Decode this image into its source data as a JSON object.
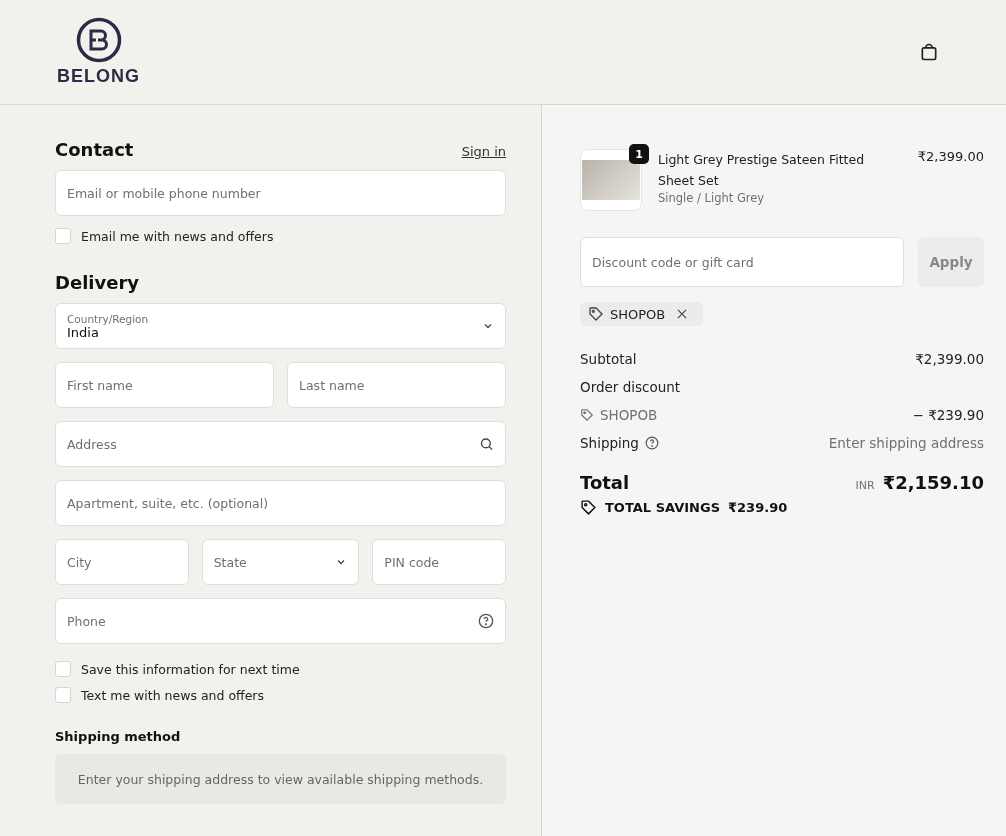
{
  "header": {
    "brand": "BELONG"
  },
  "contact": {
    "title": "Contact",
    "sign_in": "Sign in",
    "email": {
      "placeholder": "Email or mobile phone number"
    },
    "newsletter": {
      "label": "Email me with news and offers",
      "checked": false
    }
  },
  "delivery": {
    "title": "Delivery",
    "rows": [
      [
        {
          "kind": "select",
          "label": "Country/Region",
          "value": "India"
        }
      ],
      [
        {
          "kind": "text",
          "placeholder": "First name"
        },
        {
          "kind": "text",
          "placeholder": "Last name"
        }
      ],
      [
        {
          "kind": "search",
          "placeholder": "Address"
        }
      ],
      [
        {
          "kind": "text",
          "placeholder": "Apartment, suite, etc. (optional)"
        }
      ],
      [
        {
          "kind": "text",
          "placeholder": "City"
        },
        {
          "kind": "select",
          "placeholder": "State"
        },
        {
          "kind": "text",
          "placeholder": "PIN code"
        }
      ],
      [
        {
          "kind": "help",
          "placeholder": "Phone"
        }
      ]
    ],
    "options": [
      {
        "label": "Save this information for next time",
        "checked": false
      },
      {
        "label": "Text me with news and offers",
        "checked": false
      }
    ]
  },
  "shipping_method": {
    "title": "Shipping method",
    "notice": "Enter your shipping address to view available shipping methods."
  },
  "summary": {
    "item": {
      "quantity": "1",
      "name": "Light Grey Prestige Sateen Fitted Sheet Set",
      "variant": "Single / Light Grey",
      "price": "₹2,399.00"
    },
    "discount": {
      "placeholder": "Discount code or gift card",
      "button": "Apply"
    },
    "applied_code": "SHOPOB",
    "lines": [
      {
        "kind": "plain",
        "label": "Subtotal",
        "value": "₹2,399.00"
      },
      {
        "kind": "heading",
        "label": "Order discount"
      },
      {
        "kind": "code",
        "label": "SHOPOB",
        "value": "− ₹239.90"
      },
      {
        "kind": "help",
        "label": "Shipping",
        "value": "Enter shipping address"
      }
    ],
    "total": {
      "label": "Total",
      "currency": "INR",
      "value": "₹2,159.10"
    },
    "savings": {
      "label": "TOTAL SAVINGS",
      "value": "₹239.90"
    }
  }
}
